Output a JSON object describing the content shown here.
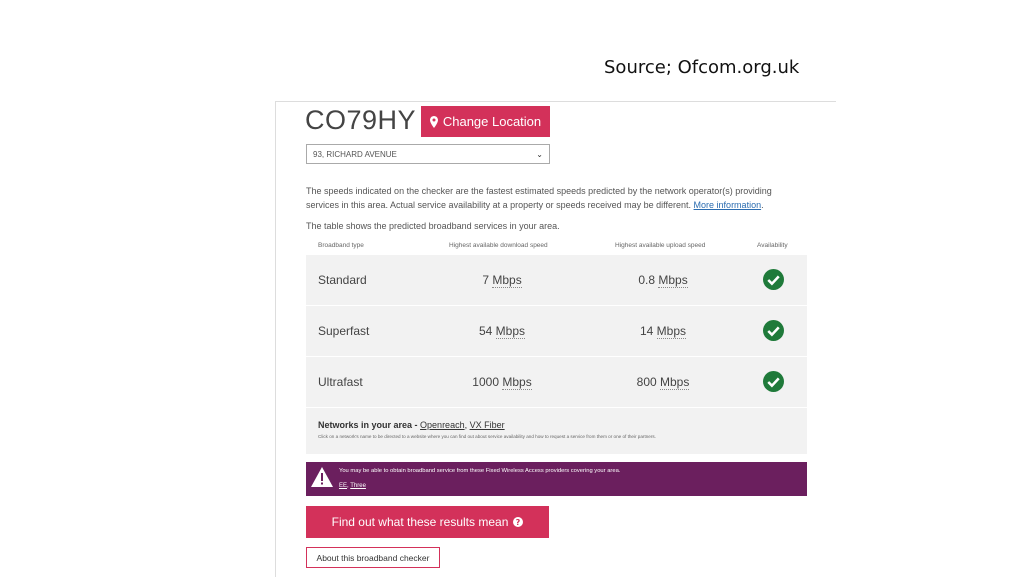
{
  "source_caption": "Source; Ofcom.org.uk",
  "location": {
    "postcode": "CO79HY",
    "change_button_label": "Change Location",
    "address_selected": "93, RICHARD AVENUE"
  },
  "intro": {
    "text": "The speeds indicated on the checker are the fastest estimated speeds predicted by the network operator(s) providing services in this area. Actual service availability at a property or speeds received may be different.",
    "more_link": "More information",
    "table_intro": "The table shows the predicted broadband services in your area."
  },
  "table": {
    "headers": [
      "Broadband type",
      "Highest available download speed",
      "Highest available upload speed",
      "Availability"
    ],
    "rows": [
      {
        "type": "Standard",
        "download": "7",
        "upload": "0.8",
        "unit": "Mbps",
        "available": true
      },
      {
        "type": "Superfast",
        "download": "54",
        "upload": "14",
        "unit": "Mbps",
        "available": true
      },
      {
        "type": "Ultrafast",
        "download": "1000",
        "upload": "800",
        "unit": "Mbps",
        "available": true
      }
    ]
  },
  "networks": {
    "label": "Networks in your area",
    "separator": " - ",
    "links": [
      "Openreach",
      "VX Fiber"
    ],
    "note": "Click on a network's name to be directed to a website where you can find out about service availability and how to request a service from them or one of their partners."
  },
  "warning": {
    "text": "You may be able to obtain broadband service from these Fixed Wireless Access providers covering your area.",
    "links": [
      "EE",
      "Three"
    ],
    "color": "#6b1f5e"
  },
  "buttons": {
    "results_label": "Find out what these results mean",
    "about_label": "About this broadband checker"
  },
  "colors": {
    "accent": "#d3315a",
    "check": "#1f7a3a"
  }
}
